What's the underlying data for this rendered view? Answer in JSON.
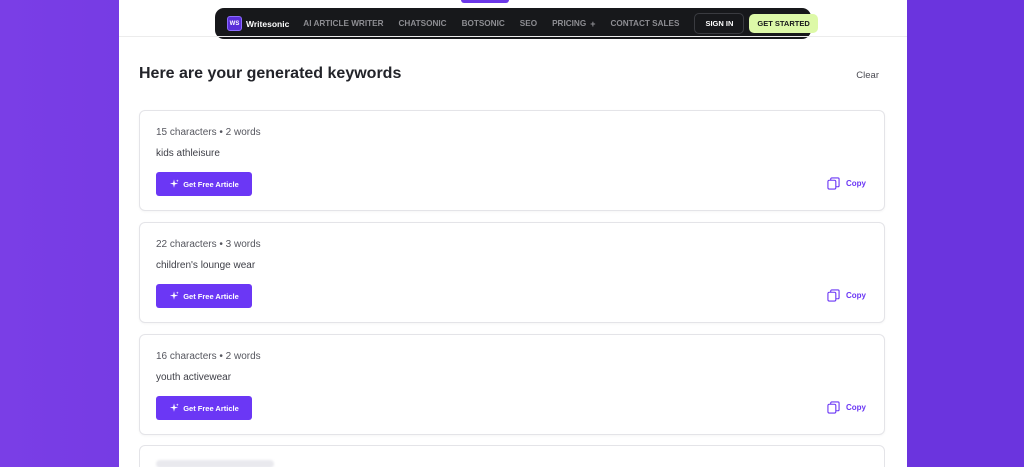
{
  "navbar": {
    "brand": "Writesonic",
    "logo_mark": "WS",
    "links": [
      {
        "label": "AI ARTICLE WRITER",
        "plus": ""
      },
      {
        "label": "CHATSONIC",
        "plus": ""
      },
      {
        "label": "BOTSONIC",
        "plus": ""
      },
      {
        "label": "SEO",
        "plus": ""
      },
      {
        "label": "PRICING",
        "plus": "+"
      },
      {
        "label": "CONTACT SALES",
        "plus": ""
      }
    ],
    "sign_in": "SIGN IN",
    "get_started": "GET STARTED"
  },
  "main": {
    "heading": "Here are your generated keywords",
    "clear_label": "Clear"
  },
  "keywords": [
    {
      "meta": "15 characters • 2 words",
      "keyword": "kids athleisure",
      "action": "Get Free Article",
      "copy": "Copy"
    },
    {
      "meta": "22 characters • 3 words",
      "keyword": "children's lounge wear",
      "action": "Get Free Article",
      "copy": "Copy"
    },
    {
      "meta": "16 characters • 2 words",
      "keyword": "youth activewear",
      "action": "Get Free Article",
      "copy": "Copy"
    }
  ],
  "colors": {
    "accent": "#6b37f5",
    "navbar_bg": "#17181b",
    "cta_bg": "#ddf9a8",
    "page_bg": "#6c35df"
  },
  "icons": {
    "sparkle": "sparkle-icon",
    "copy": "copy-icon"
  }
}
